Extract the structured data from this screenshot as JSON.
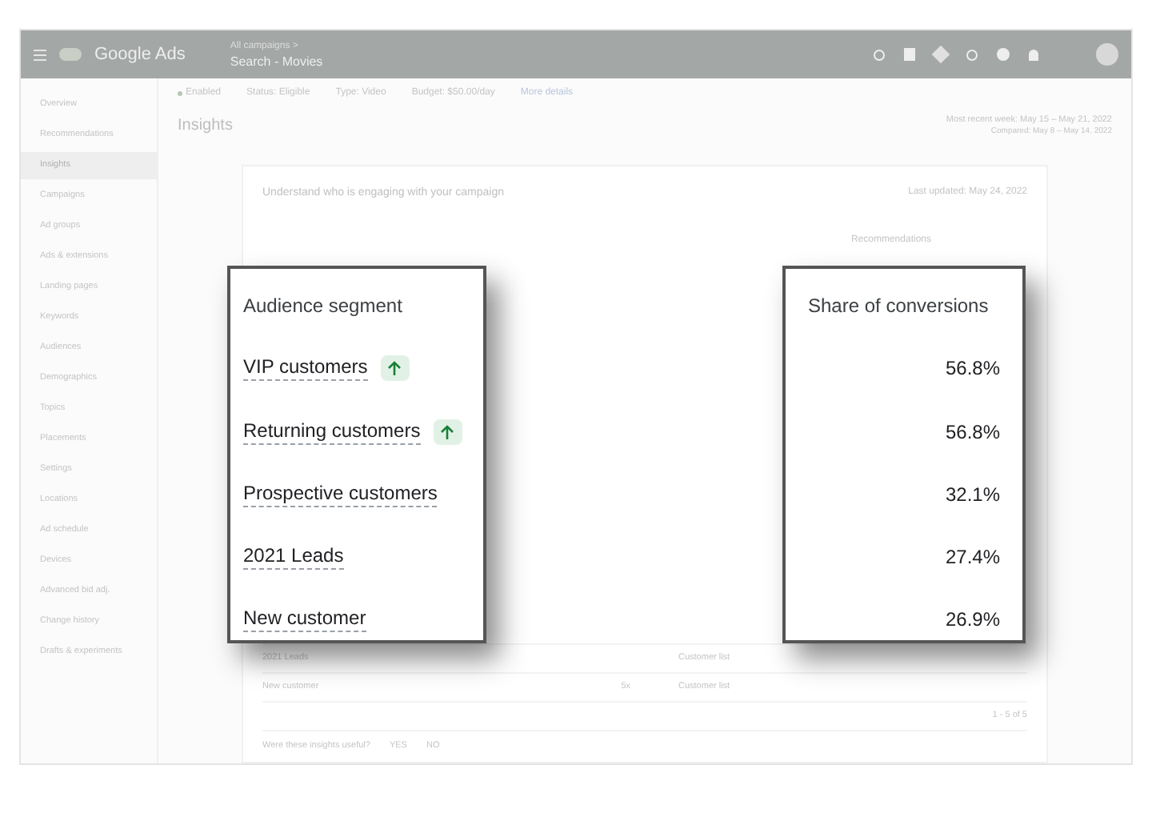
{
  "header": {
    "product": "Google Ads",
    "breadcrumb": "All campaigns >",
    "campaign": "Search - Movies"
  },
  "filters": [
    {
      "label": "Enabled",
      "kind": "status"
    },
    {
      "label": "Status: Eligible",
      "kind": "plain"
    },
    {
      "label": "Type: Video",
      "kind": "plain"
    },
    {
      "label": "Budget: $50.00/day",
      "kind": "plain"
    },
    {
      "label": "More details",
      "kind": "link"
    }
  ],
  "page_title": "Insights",
  "date_range": {
    "current": "Most recent week: May 15 – May 21, 2022",
    "compared": "Compared: May 8 – May 14, 2022"
  },
  "sidebar": {
    "items": [
      {
        "label": "Overview",
        "selected": false
      },
      {
        "label": "Recommendations",
        "selected": false
      },
      {
        "label": "Insights",
        "selected": true
      },
      {
        "label": "Campaigns",
        "selected": false
      },
      {
        "label": "Ad groups",
        "selected": false
      },
      {
        "label": "Ads & extensions",
        "selected": false
      },
      {
        "label": "Landing pages",
        "selected": false
      },
      {
        "label": "Keywords",
        "selected": false
      },
      {
        "label": "Audiences",
        "selected": false
      },
      {
        "label": "Demographics",
        "selected": false
      },
      {
        "label": "Topics",
        "selected": false
      },
      {
        "label": "Placements",
        "selected": false
      },
      {
        "label": "Settings",
        "selected": false
      },
      {
        "label": "Locations",
        "selected": false
      },
      {
        "label": "Ad schedule",
        "selected": false
      },
      {
        "label": "Devices",
        "selected": false
      },
      {
        "label": "Advanced bid adj.",
        "selected": false
      },
      {
        "label": "Change history",
        "selected": false
      },
      {
        "label": "Drafts & experiments",
        "selected": false
      }
    ]
  },
  "section": {
    "title": "Understand who is engaging with your campaign",
    "updated": "Last updated: May 24, 2022",
    "recommendations": "Recommendations"
  },
  "background_rows": [
    {
      "segment": "2021 Leads",
      "type": "Customer list"
    },
    {
      "segment": "New customer",
      "lift": "5x",
      "type": "Customer list"
    }
  ],
  "pagination": "1 - 5 of 5",
  "feedback": {
    "question": "Were these insights useful?",
    "yes": "YES",
    "no": "NO"
  },
  "segment_card": {
    "header": "Audience segment",
    "rows": [
      {
        "label": "VIP customers",
        "trending_up": true
      },
      {
        "label": "Returning customers",
        "trending_up": true
      },
      {
        "label": "Prospective customers",
        "trending_up": false
      },
      {
        "label": "2021 Leads",
        "trending_up": false
      },
      {
        "label": "New customer",
        "trending_up": false
      }
    ]
  },
  "share_card": {
    "header": "Share of conversions",
    "values": [
      "56.8%",
      "56.8%",
      "32.1%",
      "27.4%",
      "26.9%"
    ]
  }
}
